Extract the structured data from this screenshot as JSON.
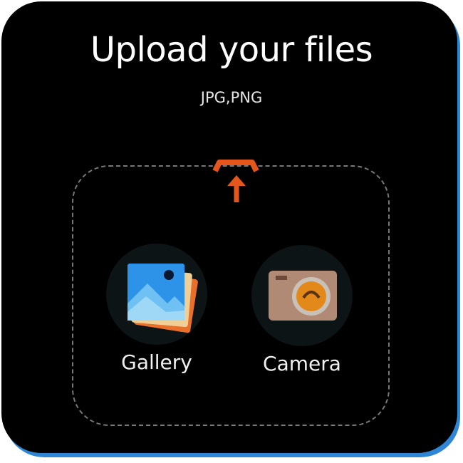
{
  "header": {
    "title": "Upload your files",
    "formats": "JPG,PNG"
  },
  "options": {
    "gallery": {
      "label": "Gallery",
      "icon": "gallery-icon"
    },
    "camera": {
      "label": "Camera",
      "icon": "camera-icon"
    }
  },
  "icons": {
    "upload": "upload-icon"
  },
  "colors": {
    "background": "#000000",
    "accent_upload": "#e4561b",
    "card_border": "#2f86d6",
    "dropzone_border": "#777777"
  }
}
